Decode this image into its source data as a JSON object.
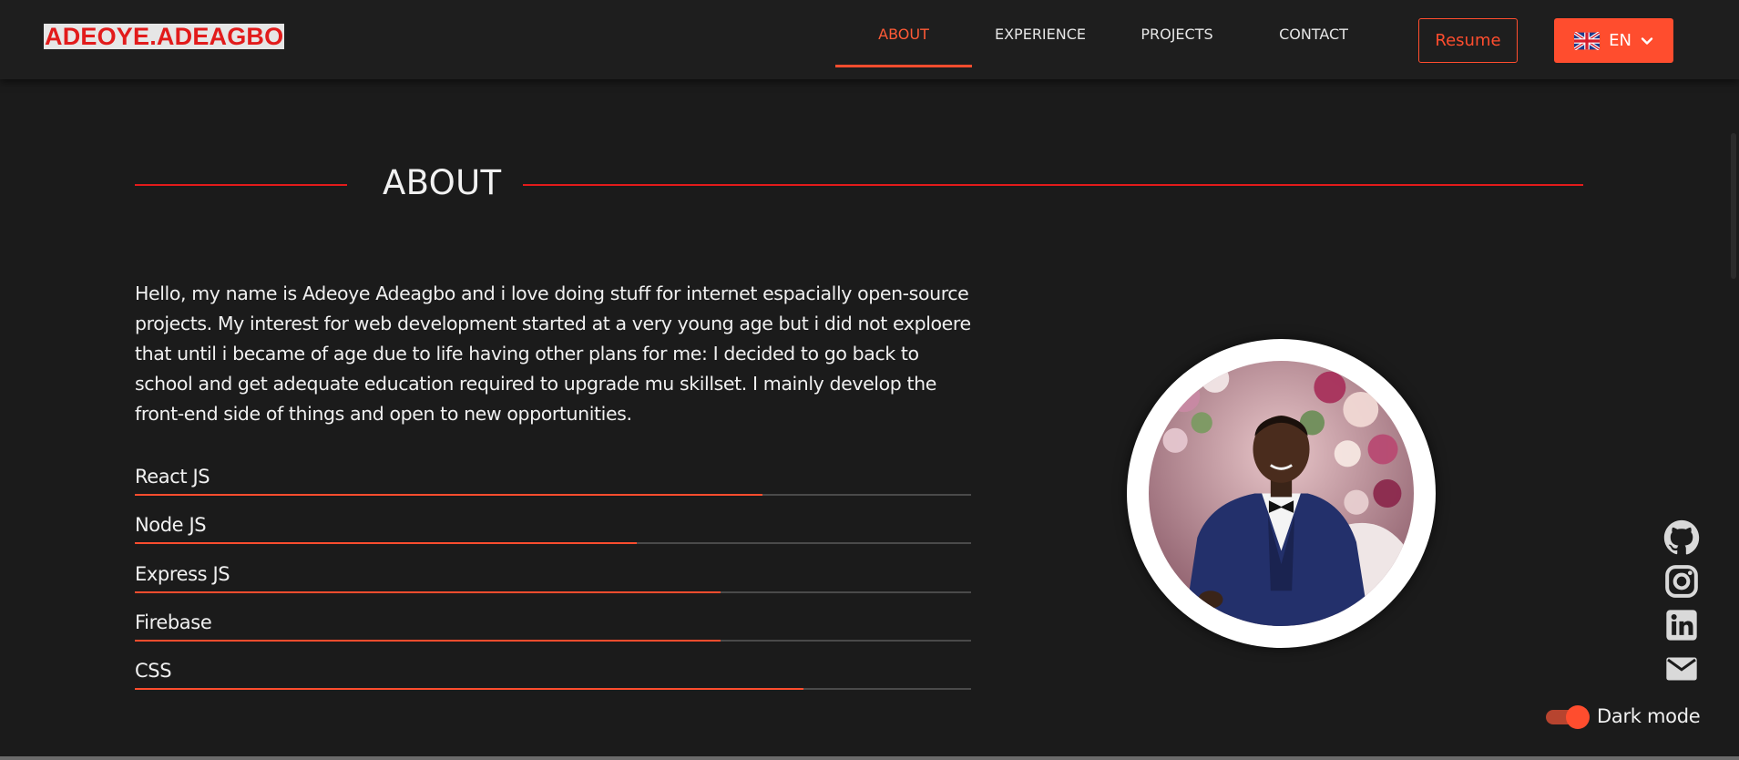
{
  "brand": {
    "logo_text": "ADEOYE.ADEAGBO"
  },
  "nav": {
    "links": [
      {
        "label": "ABOUT",
        "active": true
      },
      {
        "label": "EXPERIENCE",
        "active": false
      },
      {
        "label": "PROJECTS",
        "active": false
      },
      {
        "label": "CONTACT",
        "active": false
      }
    ],
    "resume_label": "Resume",
    "language": {
      "selected": "EN",
      "flag_icon": "uk-flag-icon",
      "chevron_icon": "chevron-down-icon"
    }
  },
  "about": {
    "title": "ABOUT",
    "paragraph": "Hello, my name is Adeoye Adeagbo and i love doing stuff for internet espacially open-source projects. My interest for web development started at a very young age but i did not exploere that until i became of age due to life having other plans for me: I decided to go back to school and get adequate education required to upgrade mu skillset. I mainly develop the front-end side of things and open to new opportunities."
  },
  "skills": [
    {
      "label": "React JS",
      "level": 0.75
    },
    {
      "label": "Node JS",
      "level": 0.6
    },
    {
      "label": "Express JS",
      "level": 0.7
    },
    {
      "label": "Firebase",
      "level": 0.7
    },
    {
      "label": "CSS",
      "level": 0.8
    }
  ],
  "social": [
    {
      "name": "github-icon"
    },
    {
      "name": "instagram-icon"
    },
    {
      "name": "linkedin-icon"
    },
    {
      "name": "email-icon"
    }
  ],
  "theme": {
    "darkmode_label": "Dark mode",
    "darkmode_on": true
  },
  "colors": {
    "accent": "#ff4d2e",
    "heading_line": "#e21b1b",
    "background": "#1b1b1b",
    "navbar": "#1e1e1e",
    "logo_red": "#e21b1b"
  }
}
